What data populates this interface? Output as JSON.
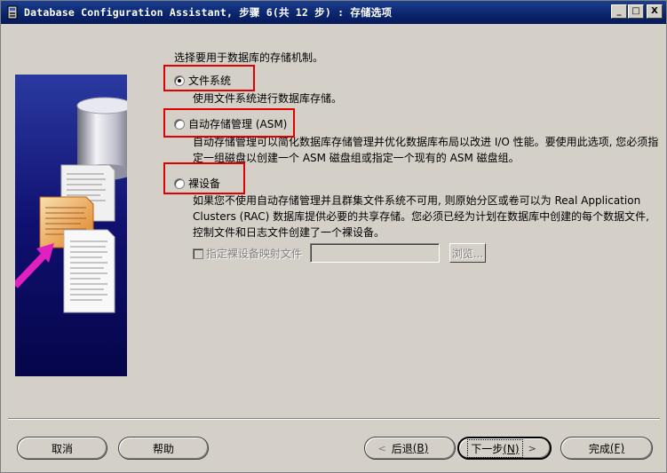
{
  "window": {
    "title": "Database Configuration Assistant, 步骤 6(共 12 步) : 存储选项",
    "minimize_glyph": "_",
    "maximize_glyph": "□",
    "close_glyph": "X"
  },
  "prompt": "选择要用于数据库的存储机制。",
  "options": [
    {
      "label": "文件系统",
      "checked": true,
      "description": [
        "使用文件系统进行数据库存储。"
      ]
    },
    {
      "label": "自动存储管理 (ASM)",
      "checked": false,
      "description": [
        "自动存储管理可以简化数据库存储管理并优化数据库布局以改进 I/O 性能。要使用此选项, 您必须指",
        "定一组磁盘以创建一个 ASM 磁盘组或指定一个现有的 ASM 磁盘组。"
      ]
    },
    {
      "label": "裸设备",
      "checked": false,
      "description": [
        "如果您不使用自动存储管理并且群集文件系统不可用, 则原始分区或卷可以为 Real Application",
        "Clusters (RAC) 数据库提供必要的共享存储。您必须已经为计划在数据库中创建的每个数据文件,",
        "控制文件和日志文件创建了一个裸设备。"
      ]
    }
  ],
  "rawmap": {
    "checkbox_label": "指定裸设备映射文件",
    "value": "",
    "browse_label": "浏览..."
  },
  "buttons": {
    "cancel": "取消",
    "help": "帮助",
    "back_label": "后退",
    "back_key": "(B)",
    "next_label": "下一步",
    "next_key": "(N)",
    "finish_label": "完成",
    "finish_key": "(F)"
  },
  "colors": {
    "highlight": "#e00000",
    "titlebar": "#0a246a",
    "panel": "#d4d0c8",
    "art_background": "#10106a"
  }
}
